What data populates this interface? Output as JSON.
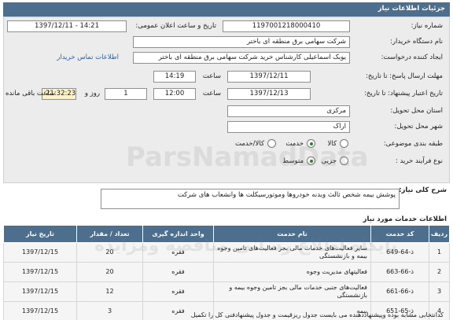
{
  "header": {
    "title": "جزئیات اطلاعات نیاز"
  },
  "form": {
    "need_number": {
      "label": "شماره نیاز:",
      "value": "1197001218000410"
    },
    "announce_datetime": {
      "label": "تاریخ و ساعت اعلان عمومی:",
      "value": "1397/12/11 - 14:21"
    },
    "buyer_org": {
      "label": "نام دستگاه خریدار:",
      "value": "شرکت سهامی برق منطقه ای باختر"
    },
    "creator": {
      "label": "ایجاد کننده درخواست:",
      "value": "یوبک اسماعیلی کارشناس خرید شرکت سهامی برق منطقه ای باختر"
    },
    "contact_link": "اطلاعات تماس خریدار",
    "send_deadline": {
      "label": "مهلت ارسال پاسخ: تا تاریخ:",
      "date": "1397/12/11",
      "time_label": "ساعت",
      "time": "14:19"
    },
    "validity_deadline": {
      "label": "تاریخ اعتبار پیشنهاد: تا تاریخ:",
      "date": "1397/12/13",
      "time_label": "ساعت",
      "time": "12:00",
      "days": "1",
      "days_label": "روز و",
      "remaining_time": "21:32:23",
      "remaining_label": "ساعت باقی مانده"
    },
    "province": {
      "label": "استان محل تحویل:",
      "value": "مرکزی"
    },
    "city": {
      "label": "شهر محل تحویل:",
      "value": "اراک"
    },
    "category": {
      "label": "طبقه بندی موضوعی:",
      "options": [
        "کالا",
        "خدمت",
        "کالا/خدمت"
      ],
      "selected": "خدمت"
    },
    "process_type": {
      "label": "نوع فرآیند خرید :",
      "options": [
        "جزیی",
        "متوسط"
      ],
      "selected": "متوسط"
    }
  },
  "description": {
    "label": "شرح کلی نیاز:",
    "text": "پوشش بیمه شخص ثالث وبدنه خودروها وموتورسیکلت ها وانشعاب های شرکت"
  },
  "services": {
    "title": "اطلاعات خدمات مورد نیاز",
    "columns": [
      "ردیف",
      "کد خدمت",
      "نام خدمت",
      "واحد اندازه گیری",
      "تعداد / مقدار",
      "تاریخ نیاز"
    ],
    "rows": [
      {
        "index": "1",
        "code": "ذ-64-649",
        "name": "سایر فعالیت‌های خدمات مالی بجز فعالیت‌های تامین وجوه بیمه و بازنشستگی",
        "unit": "فقره",
        "qty": "20",
        "date": "1397/12/15"
      },
      {
        "index": "2",
        "code": "ذ-66-663",
        "name": "فعالیتهای مدیریت وجوه",
        "unit": "فقره",
        "qty": "20",
        "date": "1397/12/15"
      },
      {
        "index": "3",
        "code": "ذ-66-661",
        "name": "فعالیت‌های جنبی خدمات مالی بجز تامین وجوه بیمه و بازنشستگی",
        "unit": "فقره",
        "qty": "12",
        "date": "1397/12/15"
      },
      {
        "index": "4",
        "code": "ذ-65-651",
        "name": "بیمه",
        "unit": "فقره",
        "qty": "3",
        "date": "1397/12/15"
      }
    ]
  },
  "footer": {
    "text": "کدانتخابی مشابه بوده وپیشنهاددهنده می بایست جدول ریزقیمت و جدول پیشنهادفنی کل را تکمیل"
  },
  "watermarks": [
    "ParsNamadData",
    "پایگاه اطلاع رسانی مناقصه ومزایده"
  ]
}
